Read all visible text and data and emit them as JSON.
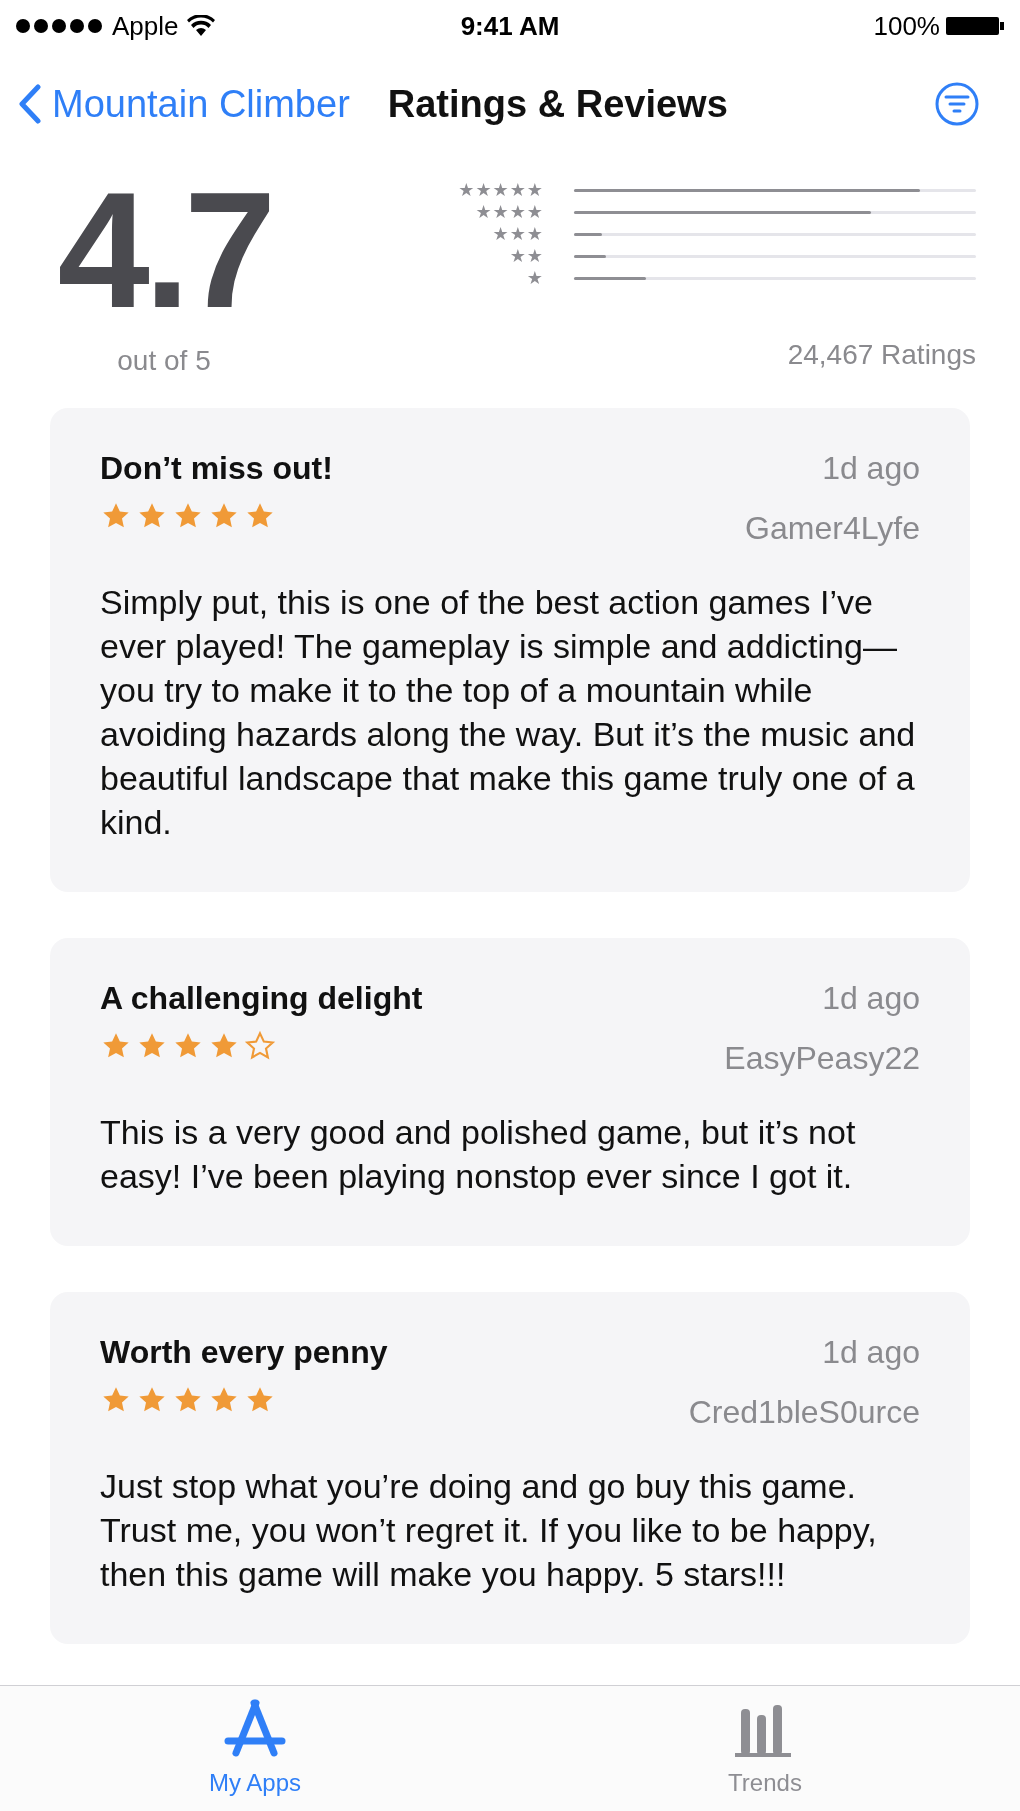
{
  "status_bar": {
    "carrier": "Apple",
    "time": "9:41 AM",
    "battery": "100%"
  },
  "nav": {
    "back": "Mountain Climber",
    "title": "Ratings & Reviews"
  },
  "summary": {
    "score": "4.7",
    "out_of": "out of 5",
    "count": "24,467 Ratings",
    "histogram": [
      {
        "label": "★★★★★",
        "level": 0.86
      },
      {
        "label": "★★★★",
        "level": 0.74
      },
      {
        "label": "★★★",
        "level": 0.07
      },
      {
        "label": "★★",
        "level": 0.08
      },
      {
        "label": "★",
        "level": 0.18
      }
    ]
  },
  "reviews": [
    {
      "title": "Don’t miss out!",
      "date": "1d ago",
      "author": "Gamer4Lyfe",
      "stars": 5,
      "body": "Simply put, this is one of the best action games I’ve ever played! The gameplay is simple and addicting—you try to make it to the top of a mountain while avoiding hazards along the way. But it’s the music and beautiful landscape that make this game truly one of a kind."
    },
    {
      "title": "A challenging delight",
      "date": "1d ago",
      "author": "EasyPeasy22",
      "stars": 4,
      "body": "This is a very good and polished game, but it’s not easy! I’ve been playing nonstop ever since I got it."
    },
    {
      "title": "Worth every penny",
      "date": "1d ago",
      "author": "Cred1bleS0urce",
      "stars": 5,
      "body": "Just stop what you’re doing and go buy this game. Trust me, you won’t regret it. If you like to be happy, then this game will make you happy. 5 stars!!!"
    }
  ],
  "tabs": [
    {
      "label": "My Apps",
      "kind": "apps",
      "selected": true
    },
    {
      "label": "Trends",
      "kind": "trends",
      "selected": false
    }
  ]
}
